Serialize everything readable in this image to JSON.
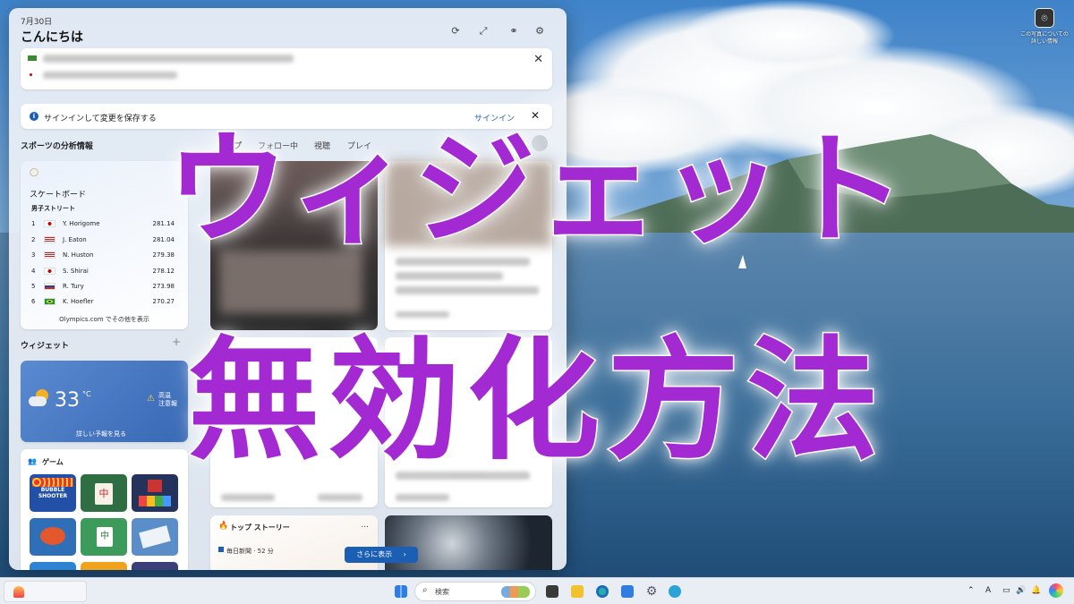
{
  "panel": {
    "date": "7月30日",
    "greeting": "こんにちは",
    "header_icons": [
      "refresh-icon",
      "expand-icon",
      "link-icon",
      "gear-icon"
    ]
  },
  "signin_bar": {
    "message": "サインインして変更を保存する",
    "link": "サインイン"
  },
  "sports": {
    "section_title": "スポーツの分析情報",
    "card_title": "スケートボード",
    "category": "男子ストリート",
    "rankings": [
      {
        "rank": "1",
        "country": "Japan",
        "name": "Y. Horigome",
        "score": "281.14"
      },
      {
        "rank": "2",
        "country": "USA",
        "name": "J. Eaton",
        "score": "281.04"
      },
      {
        "rank": "3",
        "country": "USA",
        "name": "N. Huston",
        "score": "279.38"
      },
      {
        "rank": "4",
        "country": "Japan",
        "name": "S. Shirai",
        "score": "278.12"
      },
      {
        "rank": "5",
        "country": "Slovakia",
        "name": "R. Tury",
        "score": "273.98"
      },
      {
        "rank": "6",
        "country": "Brazil",
        "name": "K. Hoefler",
        "score": "270.27"
      }
    ],
    "link": "Olympics.com でその他を表示"
  },
  "feed_tabs": [
    "トップ",
    "フォロー中",
    "視聴",
    "プレイ"
  ],
  "widgets": {
    "section_title": "ウィジェット",
    "add_icon": "+"
  },
  "weather": {
    "temperature": "33",
    "unit": "°C",
    "alert_line1": "高温",
    "alert_line2": "注意報",
    "forecast_link": "詳しい予報を見る"
  },
  "games": {
    "title": "ゲーム",
    "tiles": [
      "BUBBLE SHOOTER",
      "Mahjong",
      "Tetris blocks",
      "Fish game",
      "Mahjong Solitaire",
      "Solitaire",
      "Game 7",
      "Game 8",
      "Game 9"
    ],
    "tile_label": "BUBBLE\nSHOOTER"
  },
  "top_stories": {
    "title": "トップ ストーリー",
    "more": "...",
    "source": "毎日新聞 · 52 分"
  },
  "show_more_button": "さらに表示",
  "overlay": {
    "line1": "ウィジェット",
    "line2": "無効化方法"
  },
  "taskbar": {
    "search_placeholder": "検索",
    "tray_ime": "A"
  },
  "desktop_notice": "この写真についての\n詳しい情報"
}
